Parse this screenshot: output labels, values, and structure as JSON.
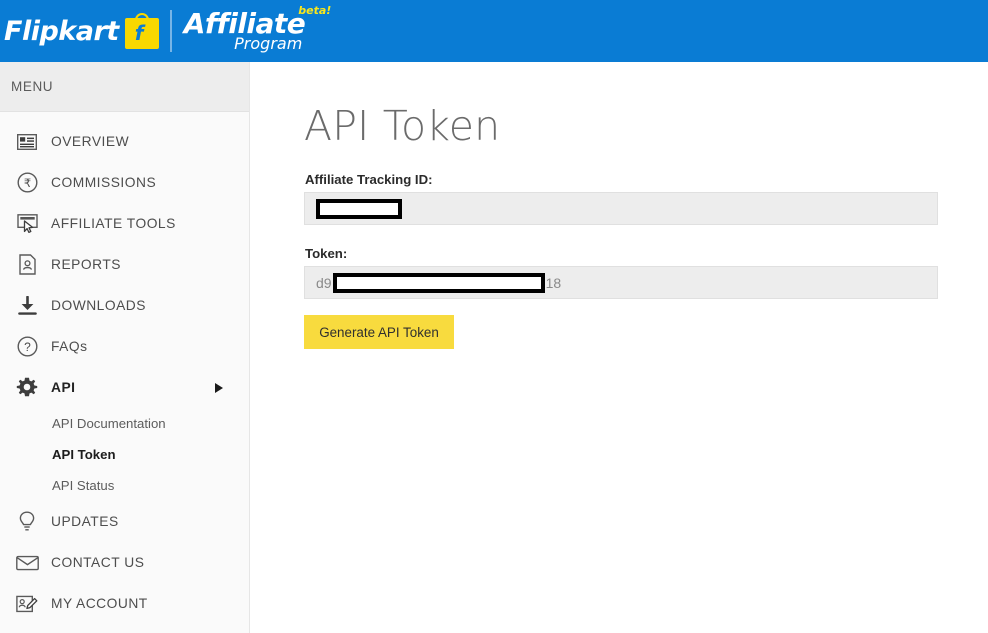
{
  "brand": {
    "flipkart": "Flipkart",
    "affiliate": "Affiliate",
    "program": "Program",
    "beta": "beta!",
    "bag_letter": "f",
    "header_color": "#0a7cd4",
    "bag_color": "#f8d800",
    "beta_color": "#f8e71c"
  },
  "sidebar": {
    "heading": "MENU",
    "items": [
      {
        "label": "OVERVIEW",
        "icon": "overview-icon",
        "active": false,
        "expandable": false
      },
      {
        "label": "COMMISSIONS",
        "icon": "rupee-circle-icon",
        "active": false,
        "expandable": false
      },
      {
        "label": "AFFILIATE TOOLS",
        "icon": "click-tool-icon",
        "active": false,
        "expandable": false
      },
      {
        "label": "REPORTS",
        "icon": "report-document-icon",
        "active": false,
        "expandable": false
      },
      {
        "label": "DOWNLOADS",
        "icon": "download-icon",
        "active": false,
        "expandable": false
      },
      {
        "label": "FAQs",
        "icon": "question-circle-icon",
        "active": false,
        "expandable": false
      },
      {
        "label": "API",
        "icon": "gear-icon",
        "active": true,
        "expandable": true
      },
      {
        "label": "UPDATES",
        "icon": "lightbulb-icon",
        "active": false,
        "expandable": false
      },
      {
        "label": "CONTACT US",
        "icon": "envelope-icon",
        "active": false,
        "expandable": false
      },
      {
        "label": "MY ACCOUNT",
        "icon": "account-edit-icon",
        "active": false,
        "expandable": false
      }
    ],
    "subitems": [
      {
        "label": "API Documentation",
        "active": false
      },
      {
        "label": "API Token",
        "active": true
      },
      {
        "label": "API Status",
        "active": false
      }
    ]
  },
  "main": {
    "title": "API Token",
    "tracking_id": {
      "label": "Affiliate Tracking ID:",
      "value": "",
      "redacted": true
    },
    "token": {
      "label": "Token:",
      "value_prefix": "d9",
      "value_suffix": "18",
      "redacted": true
    },
    "generate_button": {
      "label": "Generate API Token",
      "color": "#f8db3e"
    }
  }
}
